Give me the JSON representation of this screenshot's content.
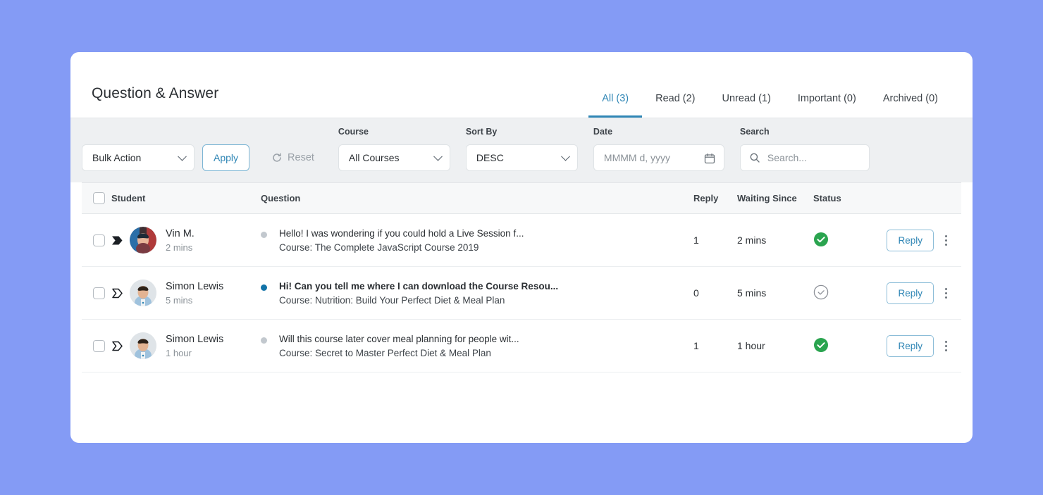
{
  "page": {
    "title": "Question & Answer",
    "background_color": "#849bf5",
    "accent_color": "#2f86b5",
    "status_ok_color": "#2aa44f"
  },
  "tabs": [
    {
      "label": "All (3)",
      "active": true
    },
    {
      "label": "Read (2)",
      "active": false
    },
    {
      "label": "Unread (1)",
      "active": false
    },
    {
      "label": "Important (0)",
      "active": false
    },
    {
      "label": "Archived (0)",
      "active": false
    }
  ],
  "toolbar": {
    "bulk_action_value": "Bulk Action",
    "apply_label": "Apply",
    "reset_label": "Reset",
    "reset_icon": "refresh-icon",
    "course_label": "Course",
    "course_value": "All Courses",
    "sort_label": "Sort By",
    "sort_value": "DESC",
    "date_label": "Date",
    "date_placeholder": "MMMM d, yyyy",
    "date_icon": "calendar-icon",
    "search_label": "Search",
    "search_placeholder": "Search...",
    "search_value": "",
    "search_icon": "search-icon"
  },
  "table": {
    "columns": {
      "student": "Student",
      "question": "Question",
      "reply": "Reply",
      "waiting": "Waiting Since",
      "status": "Status"
    },
    "rows": [
      {
        "student_name": "Vin M.",
        "student_time": "2 mins",
        "flag": "flag-filled-icon",
        "dot": "read",
        "question": "Hello! I was wondering if you could hold a Live Session f...",
        "course": "Course: The Complete JavaScript Course 2019",
        "bold": false,
        "reply_count": "1",
        "waiting_since": "2 mins",
        "status": "answered",
        "action_label": "Reply"
      },
      {
        "student_name": "Simon Lewis",
        "student_time": "5 mins",
        "flag": "flag-outline-icon",
        "dot": "unread",
        "question": "Hi! Can you tell me where I can download the Course Resou...",
        "course": "Course: Nutrition: Build Your Perfect Diet & Meal Plan",
        "bold": true,
        "reply_count": "0",
        "waiting_since": "5 mins",
        "status": "pending",
        "action_label": "Reply"
      },
      {
        "student_name": "Simon Lewis",
        "student_time": "1 hour",
        "flag": "flag-outline-icon",
        "dot": "read",
        "question": "Will this course later cover meal planning for people wit...",
        "course": "Course: Secret to Master Perfect Diet & Meal Plan",
        "bold": false,
        "reply_count": "1",
        "waiting_since": "1 hour",
        "status": "answered",
        "action_label": "Reply"
      }
    ]
  }
}
